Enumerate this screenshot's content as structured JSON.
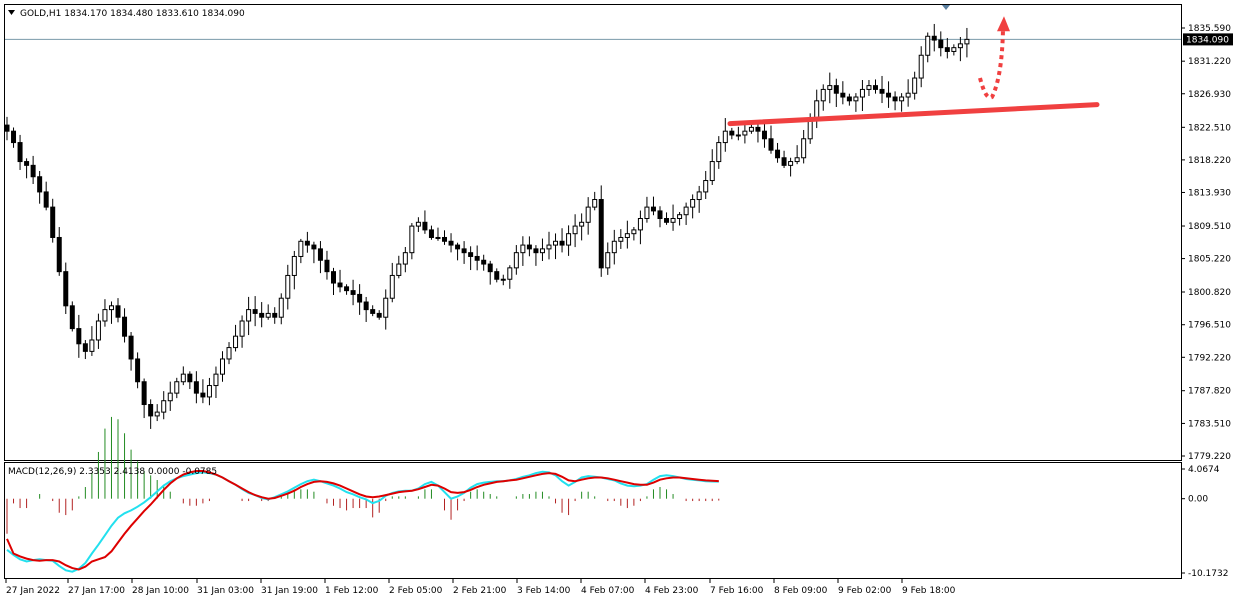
{
  "symbol_header": {
    "symbol": "GOLD",
    "timeframe": "H1",
    "open": "1834.170",
    "high": "1834.480",
    "low": "1833.610",
    "close": "1834.090"
  },
  "macd_header": {
    "label": "MACD(12,26,9)",
    "macd": "2.3353",
    "signal": "2.4138",
    "value3": "0.0000",
    "value4": "-0.0785"
  },
  "colors": {
    "bull_candle": "#2b2b2b",
    "bear_candle": "#000000",
    "macd_line": "#22e0ee",
    "signal_line": "#dd0000",
    "hist_positive": "#228b22",
    "hist_negative": "#b22222",
    "trendline": "#f04040",
    "arrow": "#f04040",
    "current_price_line": "#7a9aaa",
    "price_tag_bg": "#000000"
  },
  "chart_data": [
    {
      "type": "candlestick",
      "symbol": "GOLD",
      "timeframe": "H1",
      "ylim": [
        1779.22,
        1836.6
      ],
      "price_axis_ticks": [
        "1835.590",
        "1831.220",
        "1826.930",
        "1822.510",
        "1818.220",
        "1813.930",
        "1809.510",
        "1805.220",
        "1800.820",
        "1796.510",
        "1792.220",
        "1787.820",
        "1783.510",
        "1779.220"
      ],
      "current_price": "1834.090",
      "time_axis_labels": [
        "27 Jan 2022",
        "27 Jan 17:00",
        "28 Jan 10:00",
        "31 Jan 03:00",
        "31 Jan 19:00",
        "1 Feb 12:00",
        "2 Feb 05:00",
        "2 Feb 21:00",
        "3 Feb 14:00",
        "4 Feb 07:00",
        "4 Feb 23:00",
        "7 Feb 16:00",
        "8 Feb 09:00",
        "9 Feb 02:00",
        "9 Feb 18:00"
      ],
      "close_path": [
        1822.0,
        1820.5,
        1818.0,
        1817.5,
        1816.0,
        1814.0,
        1812.0,
        1808.0,
        1803.5,
        1799.0,
        1796.0,
        1794.0,
        1793.0,
        1794.5,
        1797.0,
        1798.5,
        1799.0,
        1797.5,
        1795.0,
        1792.0,
        1789.0,
        1786.0,
        1784.5,
        1785.0,
        1786.5,
        1787.5,
        1789.0,
        1790.0,
        1789.0,
        1787.5,
        1787.0,
        1788.5,
        1790.0,
        1792.0,
        1793.5,
        1795.0,
        1797.0,
        1798.5,
        1798.0,
        1797.5,
        1798.0,
        1797.5,
        1800.0,
        1803.0,
        1805.5,
        1807.5,
        1807.0,
        1806.5,
        1805.0,
        1803.5,
        1802.0,
        1801.5,
        1801.0,
        1800.5,
        1799.5,
        1798.5,
        1798.0,
        1797.5,
        1800.0,
        1803.0,
        1804.5,
        1806.0,
        1809.5,
        1810.0,
        1809.0,
        1808.0,
        1808.0,
        1807.5,
        1807.0,
        1806.5,
        1806.0,
        1805.5,
        1805.0,
        1804.5,
        1803.5,
        1802.5,
        1802.5,
        1804.0,
        1806.0,
        1807.0,
        1806.5,
        1806.0,
        1806.5,
        1807.0,
        1807.5,
        1807.0,
        1808.5,
        1809.5,
        1810.0,
        1812.0,
        1813.0,
        1804.0,
        1806.0,
        1807.5,
        1808.0,
        1808.5,
        1809.0,
        1810.5,
        1812.0,
        1811.5,
        1810.5,
        1810.0,
        1810.5,
        1811.0,
        1812.0,
        1813.0,
        1814.0,
        1815.5,
        1818.0,
        1820.5,
        1822.0,
        1821.5,
        1821.5,
        1822.0,
        1822.5,
        1822.0,
        1821.0,
        1819.5,
        1818.5,
        1817.5,
        1818.0,
        1818.5,
        1821.0,
        1823.5,
        1826.0,
        1827.5,
        1828.0,
        1827.0,
        1826.5,
        1826.0,
        1826.5,
        1827.5,
        1828.0,
        1827.5,
        1827.0,
        1826.5,
        1826.0,
        1826.5,
        1827.0,
        1829.0,
        1832.0,
        1834.5,
        1834.0,
        1833.0,
        1832.5,
        1833.0,
        1833.5,
        1834.09
      ],
      "annotations": [
        {
          "type": "trendline",
          "from": {
            "time": "7 Feb 16:00",
            "price": 1823.0
          },
          "to": {
            "time": "beyond last bar",
            "price": 1825.5
          },
          "color": "#f04040"
        },
        {
          "type": "dotted-arrow",
          "direction": "down-then-up",
          "start_price": 1829.0,
          "low_price": 1826.5,
          "end_price": 1837.0,
          "color": "#f04040"
        }
      ]
    },
    {
      "type": "line",
      "name": "MACD(12,26,9)",
      "ylim": [
        -10.1732,
        4.0674
      ],
      "axis_ticks": [
        "4.0674",
        "0.00",
        "-10.1732"
      ],
      "series": [
        {
          "name": "MACD",
          "values": [
            -7.0,
            -7.7,
            -8.3,
            -8.6,
            -8.4,
            -8.3,
            -8.4,
            -8.5,
            -9.2,
            -9.8,
            -10.0,
            -9.6,
            -8.8,
            -7.5,
            -6.3,
            -5.0,
            -3.7,
            -2.6,
            -2.0,
            -1.6,
            -1.1,
            -0.5,
            0.2,
            1.0,
            1.8,
            2.4,
            2.8,
            3.1,
            3.3,
            3.5,
            3.6,
            3.5,
            3.3,
            2.9,
            2.4,
            1.9,
            1.3,
            0.8,
            0.5,
            0.1,
            -0.1,
            0.2,
            0.6,
            1.0,
            1.5,
            2.0,
            2.4,
            2.6,
            2.4,
            2.1,
            1.8,
            1.4,
            0.9,
            0.6,
            0.2,
            -0.1,
            -0.6,
            -0.3,
            0.4,
            0.8,
            1.0,
            1.1,
            1.1,
            1.4,
            2.0,
            2.3,
            1.8,
            0.9,
            0.0,
            0.3,
            0.8,
            1.5,
            2.0,
            2.2,
            2.3,
            2.4,
            2.4,
            2.5,
            2.7,
            3.0,
            3.2,
            3.5,
            3.7,
            3.6,
            3.2,
            2.4,
            1.8,
            2.3,
            2.9,
            3.1,
            3.0,
            2.9,
            2.7,
            2.5,
            2.1,
            1.8,
            1.7,
            1.8,
            2.0,
            2.6,
            3.1,
            3.2,
            3.1,
            2.9,
            2.7,
            2.6,
            2.5,
            2.4,
            2.35,
            2.3353
          ]
        },
        {
          "name": "Signal",
          "values": [
            -5.5,
            -7.5,
            -7.9,
            -8.2,
            -8.4,
            -8.5,
            -8.4,
            -8.4,
            -8.6,
            -9.1,
            -9.5,
            -9.7,
            -9.3,
            -8.6,
            -8.3,
            -8.0,
            -7.2,
            -6.0,
            -4.8,
            -3.7,
            -2.7,
            -1.7,
            -0.8,
            0.2,
            1.2,
            2.1,
            2.8,
            3.3,
            3.6,
            3.8,
            3.8,
            3.6,
            3.3,
            2.9,
            2.4,
            1.9,
            1.4,
            0.9,
            0.5,
            0.2,
            0.0,
            0.1,
            0.4,
            0.7,
            1.1,
            1.6,
            2.0,
            2.3,
            2.4,
            2.3,
            2.1,
            1.8,
            1.4,
            1.0,
            0.6,
            0.3,
            0.2,
            0.3,
            0.5,
            0.7,
            0.9,
            1.0,
            1.1,
            1.3,
            1.6,
            1.9,
            1.8,
            1.4,
            0.9,
            0.8,
            0.9,
            1.2,
            1.6,
            1.9,
            2.1,
            2.3,
            2.4,
            2.5,
            2.6,
            2.8,
            3.0,
            3.2,
            3.4,
            3.5,
            3.4,
            3.0,
            2.5,
            2.4,
            2.6,
            2.8,
            2.9,
            2.9,
            2.8,
            2.6,
            2.4,
            2.2,
            2.0,
            1.9,
            1.9,
            2.2,
            2.6,
            2.8,
            2.9,
            2.9,
            2.8,
            2.7,
            2.6,
            2.5,
            2.45,
            2.4138
          ]
        }
      ]
    }
  ]
}
